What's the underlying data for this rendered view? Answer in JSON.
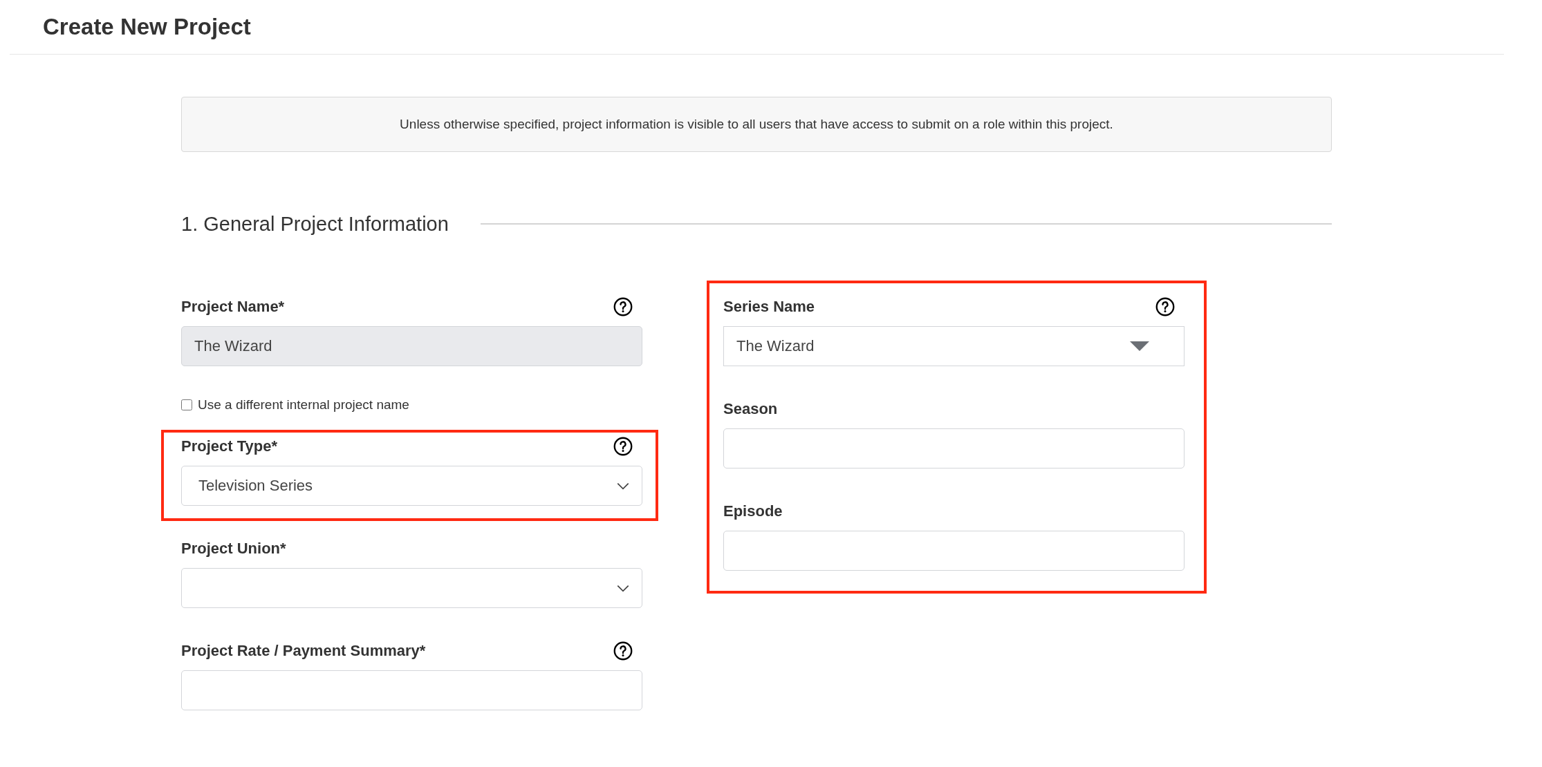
{
  "header": {
    "title": "Create New Project"
  },
  "notice": "Unless otherwise specified, project information is visible to all users that have access to submit on a role within this project.",
  "section": {
    "title": "1. General Project Information"
  },
  "columns": [
    {
      "groups": [
        {
          "highlighted": false,
          "fields": [
            {
              "kind": "text",
              "label": "Project Name*",
              "help": true,
              "value": "The Wizard",
              "disabled": true
            },
            {
              "kind": "checkbox",
              "label": "Use a different internal project name",
              "checked": false
            }
          ]
        },
        {
          "highlighted": true,
          "fields": [
            {
              "kind": "select",
              "label": "Project Type*",
              "help": true,
              "value": "Television Series"
            }
          ]
        },
        {
          "highlighted": false,
          "fields": [
            {
              "kind": "select",
              "label": "Project Union*",
              "help": false
            },
            {
              "kind": "text",
              "label": "Project Rate / Payment Summary*",
              "help": true,
              "disabled": false
            }
          ]
        }
      ]
    },
    {
      "groups": [
        {
          "highlighted": true,
          "fields": [
            {
              "kind": "combo",
              "label": "Series Name",
              "help": true,
              "value": "The Wizard"
            },
            {
              "kind": "text",
              "label": "Season",
              "help": false,
              "disabled": false
            },
            {
              "kind": "text",
              "label": "Episode",
              "help": false,
              "disabled": false
            }
          ]
        }
      ]
    }
  ]
}
